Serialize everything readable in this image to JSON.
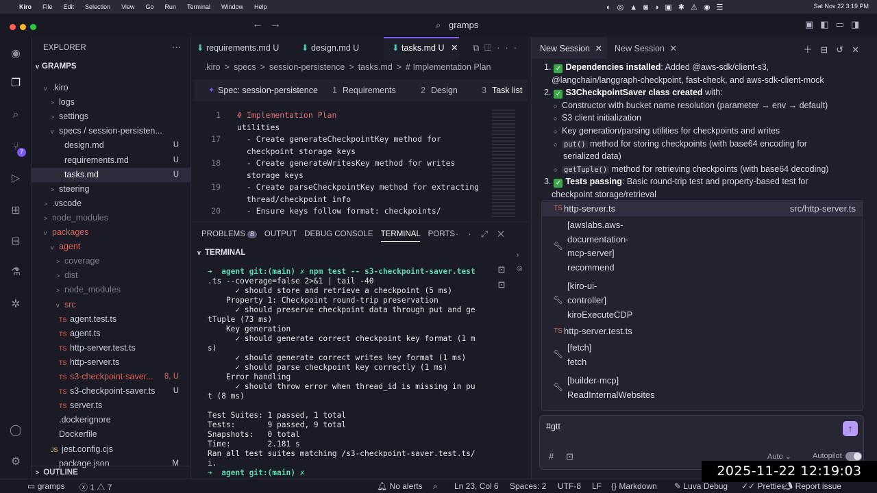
{
  "menubar": {
    "apple": "",
    "app": "Kiro",
    "items": [
      "File",
      "Edit",
      "Selection",
      "View",
      "Go",
      "Run",
      "Terminal",
      "Window",
      "Help"
    ],
    "datetime": "Sat Nov 22  3:19 PM"
  },
  "titlebar": {
    "search": "gramps"
  },
  "explorer": {
    "title": "EXPLORER",
    "root": "GRAMPS",
    "rows": [
      {
        "label": ".kiro",
        "indent": 18,
        "arrow": "v",
        "color": "#c9c9d6",
        "badge": "",
        "badge_color": ""
      },
      {
        "label": "logs",
        "indent": 28,
        "arrow": ">",
        "color": "#c9c9d6",
        "badge": "",
        "badge_color": ""
      },
      {
        "label": "settings",
        "indent": 28,
        "arrow": ">",
        "color": "#c9c9d6",
        "badge": "",
        "badge_color": ""
      },
      {
        "label": "specs / session-persisten...",
        "indent": 28,
        "arrow": "v",
        "color": "#c9c9d6",
        "badge": "",
        "badge_color": ""
      },
      {
        "label": "design.md",
        "indent": 36,
        "arrow": "",
        "color": "#c9c9d6",
        "badge": "U",
        "badge_color": "#c9c9d6"
      },
      {
        "label": "requirements.md",
        "indent": 36,
        "arrow": "",
        "color": "#c9c9d6",
        "badge": "U",
        "badge_color": "#c9c9d6"
      },
      {
        "label": "tasks.md",
        "indent": 36,
        "arrow": "",
        "color": "#ffffff",
        "badge": "U",
        "badge_color": "#c9c9d6"
      },
      {
        "label": "steering",
        "indent": 28,
        "arrow": ">",
        "color": "#c9c9d6",
        "badge": "",
        "badge_color": ""
      },
      {
        "label": ".vscode",
        "indent": 18,
        "arrow": ">",
        "color": "#c9c9d6",
        "badge": "",
        "badge_color": ""
      },
      {
        "label": "node_modules",
        "indent": 18,
        "arrow": ">",
        "color": "#7a7a8a",
        "badge": "",
        "badge_color": ""
      },
      {
        "label": "packages",
        "indent": 18,
        "arrow": "v",
        "color": "#d9655a",
        "badge": "",
        "badge_color": ""
      },
      {
        "label": "agent",
        "indent": 28,
        "arrow": "v",
        "color": "#d9655a",
        "badge": "",
        "badge_color": ""
      },
      {
        "label": "coverage",
        "indent": 36,
        "arrow": ">",
        "color": "#7a7a8a",
        "badge": "",
        "badge_color": ""
      },
      {
        "label": "dist",
        "indent": 36,
        "arrow": ">",
        "color": "#7a7a8a",
        "badge": "",
        "badge_color": ""
      },
      {
        "label": "node_modules",
        "indent": 36,
        "arrow": ">",
        "color": "#7a7a8a",
        "badge": "",
        "badge_color": ""
      },
      {
        "label": "src",
        "indent": 36,
        "arrow": "v",
        "color": "#d9655a",
        "badge": "",
        "badge_color": ""
      },
      {
        "label": "agent.test.ts",
        "indent": 40,
        "arrow": "TS",
        "color": "#c9c9d6",
        "badge": "",
        "badge_color": ""
      },
      {
        "label": "agent.ts",
        "indent": 40,
        "arrow": "TS",
        "color": "#c9c9d6",
        "badge": "",
        "badge_color": ""
      },
      {
        "label": "http-server.test.ts",
        "indent": 40,
        "arrow": "TS",
        "color": "#c9c9d6",
        "badge": "",
        "badge_color": ""
      },
      {
        "label": "http-server.ts",
        "indent": 40,
        "arrow": "TS",
        "color": "#c9c9d6",
        "badge": "",
        "badge_color": ""
      },
      {
        "label": "s3-checkpoint-saver...",
        "indent": 40,
        "arrow": "TS",
        "color": "#d9655a",
        "badge": "8, U",
        "badge_color": "#d9655a"
      },
      {
        "label": "s3-checkpoint-saver.ts",
        "indent": 40,
        "arrow": "TS",
        "color": "#c9c9d6",
        "badge": "U",
        "badge_color": "#c9c9d6"
      },
      {
        "label": "server.ts",
        "indent": 40,
        "arrow": "TS",
        "color": "#c9c9d6",
        "badge": "",
        "badge_color": ""
      },
      {
        "label": ".dockerignore",
        "indent": 28,
        "arrow": "",
        "color": "#c9c9d6",
        "badge": "",
        "badge_color": ""
      },
      {
        "label": "Dockerfile",
        "indent": 28,
        "arrow": "",
        "color": "#c9c9d6",
        "badge": "",
        "badge_color": ""
      },
      {
        "label": "jest.config.cjs",
        "indent": 28,
        "arrow": "JS",
        "color": "#c9c9d6",
        "badge": "",
        "badge_color": ""
      },
      {
        "label": "package.json",
        "indent": 28,
        "arrow": "",
        "color": "#c9c9d6",
        "badge": "M",
        "badge_color": "#c9c9d6"
      }
    ],
    "outline": "OUTLINE"
  },
  "editor": {
    "tabs": [
      {
        "label": "requirements.md",
        "badge": "U"
      },
      {
        "label": "design.md",
        "badge": "U"
      },
      {
        "label": "tasks.md",
        "badge": "U"
      }
    ],
    "breadcrumb": [
      ".kiro",
      ">",
      "specs",
      ">",
      "session-persistence",
      ">",
      "tasks.md",
      ">",
      "# Implementation Plan"
    ],
    "spec": {
      "title": "Spec: session-persistence",
      "steps": [
        {
          "n": "1",
          "label": "Requirements"
        },
        {
          "n": "2",
          "label": "Design"
        },
        {
          "n": "3",
          "label": "Task list"
        }
      ]
    },
    "lines": [
      {
        "n": "1",
        "text": "# Implementation Plan",
        "heading": true
      },
      {
        "n": "",
        "text": "utilities",
        "heading": false
      },
      {
        "n": "17",
        "text": "  - Create generateCheckpointKey method for",
        "heading": false
      },
      {
        "n": "",
        "text": "  checkpoint storage keys",
        "heading": false
      },
      {
        "n": "18",
        "text": "  - Create generateWritesKey method for writes",
        "heading": false
      },
      {
        "n": "",
        "text": "  storage keys",
        "heading": false
      },
      {
        "n": "19",
        "text": "  - Create parseCheckpointKey method for extracting",
        "heading": false
      },
      {
        "n": "",
        "text": "  thread/checkpoint info",
        "heading": false
      },
      {
        "n": "20",
        "text": "  - Ensure keys follow format: checkpoints/",
        "heading": false
      }
    ]
  },
  "panel": {
    "tabs": [
      "PROBLEMS",
      "OUTPUT",
      "DEBUG CONSOLE",
      "TERMINAL",
      "PORTS"
    ],
    "problems_count": "8",
    "section": "TERMINAL",
    "lines": [
      "➔  agent git:(main) ✗ npm test -- s3-checkpoint-saver.test",
      ".ts --coverage=false 2>&1 | tail -40",
      "      ✓ should store and retrieve a checkpoint (5 ms)",
      "    Property 1: Checkpoint round-trip preservation",
      "      ✓ should preserve checkpoint data through put and ge",
      "tTuple (73 ms)",
      "    Key generation",
      "      ✓ should generate correct checkpoint key format (1 m",
      "s)",
      "      ✓ should generate correct writes key format (1 ms)",
      "      ✓ should parse checkpoint key correctly (1 ms)",
      "    Error handling",
      "      ✓ should throw error when thread_id is missing in pu",
      "t (8 ms)",
      "",
      "Test Suites: 1 passed, 1 total",
      "Tests:       9 passed, 9 total",
      "Snapshots:   0 total",
      "Time:        2.181 s",
      "Ran all test suites matching /s3-checkpoint-saver.test.ts/",
      "i.",
      "➔  agent git:(main) ✗"
    ]
  },
  "chat": {
    "tabs": [
      "New Session",
      "New Session"
    ],
    "items": [
      {
        "kind": "num",
        "num": "1.",
        "bold": "Dependencies installed",
        "text": ": Added @aws-sdk/client-s3,"
      },
      {
        "kind": "cont",
        "text": "@langchain/langgraph-checkpoint, fast-check, and aws-sdk-client-mock"
      },
      {
        "kind": "num",
        "num": "2.",
        "bold": "S3CheckpointSaver class created",
        "text": " with:"
      },
      {
        "kind": "bullet",
        "text": "Constructor with bucket name resolution (parameter → env → default)"
      },
      {
        "kind": "bullet",
        "text": "S3 client initialization"
      },
      {
        "kind": "bullet",
        "text": "Key generation/parsing utilities for checkpoints and writes"
      },
      {
        "kind": "bullet",
        "code": "put()",
        "text": " method for storing checkpoints (with base64 encoding for"
      },
      {
        "kind": "cont2",
        "text": "serialized data)"
      },
      {
        "kind": "bullet",
        "code": "getTuple()",
        "text": " method for retrieving checkpoints (with base64 decoding)"
      },
      {
        "kind": "num",
        "num": "3.",
        "bold": "Tests passing",
        "text": ": Basic round-trip test and property-based test for"
      },
      {
        "kind": "cont",
        "text": "checkpoint storage/retrieval"
      }
    ],
    "autocomplete": [
      {
        "type": "file",
        "label": "http-server.ts",
        "path": "src/http-server.ts"
      },
      {
        "type": "tool",
        "label": "[awslabs.aws-\ndocumentation-\nmcp-server]\nrecommend"
      },
      {
        "type": "tool",
        "label": "[kiro-ui-\ncontroller]\nkiroExecuteCDP"
      },
      {
        "type": "file",
        "label": "http-server.test.ts",
        "path": ""
      },
      {
        "type": "tool",
        "label": "[fetch]\nfetch"
      },
      {
        "type": "tool",
        "label": "[builder-mcp]\nReadInternalWebsites"
      }
    ],
    "input": "#gtt",
    "mode": "Auto",
    "autopilot": "Autopilot"
  },
  "status": {
    "project": "gramps",
    "errors": "1",
    "warnings": "7",
    "alerts": "No alerts",
    "position": "Ln 23, Col 6",
    "spaces": "Spaces: 2",
    "encoding": "UTF-8",
    "eol": "LF",
    "lang": "Markdown",
    "debug": "Luva Debug",
    "prettier": "Prettier",
    "report": "Report issue"
  },
  "overlay_clock": "2025-11-22 12:19:03"
}
